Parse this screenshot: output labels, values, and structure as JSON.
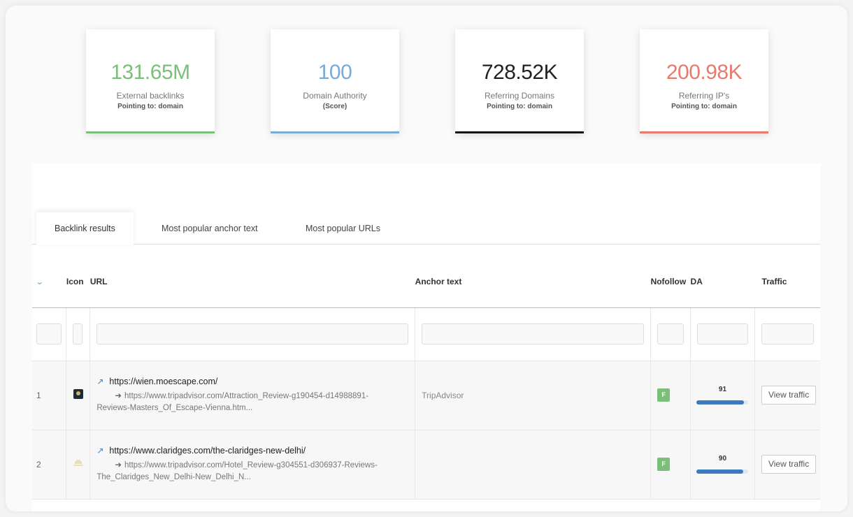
{
  "stats": [
    {
      "value": "131.65M",
      "label": "External backlinks",
      "sub": "Pointing to: domain",
      "color": "#7cbf7a"
    },
    {
      "value": "100",
      "label": "Domain Authority",
      "sub": "(Score)",
      "color": "#7aaad6"
    },
    {
      "value": "728.52K",
      "label": "Referring Domains",
      "sub": "Pointing to: domain",
      "color": "#111111"
    },
    {
      "value": "200.98K",
      "label": "Referring IP's",
      "sub": "Pointing to: domain",
      "color": "#e87a6e"
    }
  ],
  "tabs": [
    "Backlink results",
    "Most popular anchor text",
    "Most popular URLs"
  ],
  "table": {
    "sort_icon": "chevron-down-icon",
    "columns": {
      "icon": "Icon",
      "url": "URL",
      "anchor": "Anchor text",
      "nofollow": "Nofollow",
      "da": "DA",
      "traffic": "Traffic"
    },
    "rows": [
      {
        "index": "1",
        "url": "https://wien.moescape.com/",
        "source": "https://www.tripadvisor.com/Attraction_Review-g190454-d14988891-Reviews-Masters_Of_Escape-Vienna.htm...",
        "anchor": "TripAdvisor",
        "nofollow": "F",
        "da": "91",
        "da_fraction": 0.91,
        "traffic_button": "View traffic"
      },
      {
        "index": "2",
        "url": "https://www.claridges.com/the-claridges-new-delhi/",
        "source": "https://www.tripadvisor.com/Hotel_Review-g304551-d306937-Reviews-The_Claridges_New_Delhi-New_Delhi_N...",
        "anchor": "",
        "nofollow": "F",
        "da": "90",
        "da_fraction": 0.9,
        "traffic_button": "View traffic"
      }
    ]
  }
}
